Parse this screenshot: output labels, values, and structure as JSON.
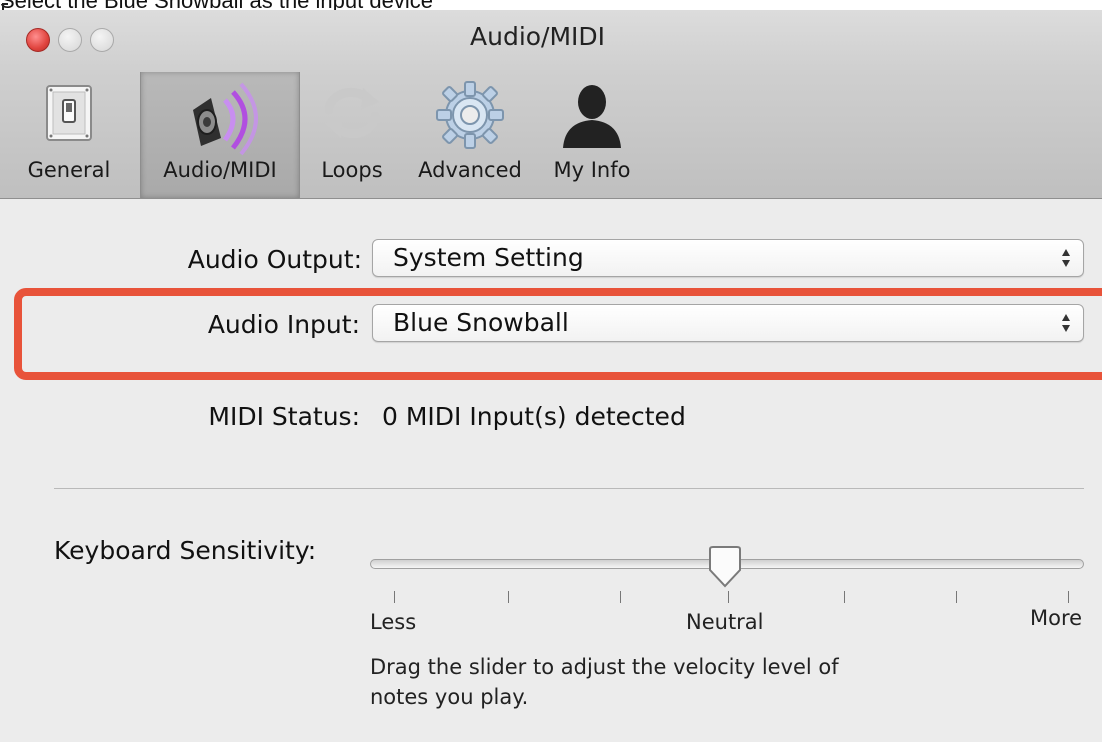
{
  "caption": "Select the Blue Snowball as the input device",
  "window": {
    "title": "Audio/MIDI",
    "controls": {
      "close": "close-button",
      "minimize": "minimize-button",
      "zoom": "zoom-button"
    }
  },
  "toolbar": {
    "items": [
      {
        "label": "General",
        "icon": "switch-icon",
        "selected": false
      },
      {
        "label": "Audio/MIDI",
        "icon": "speaker-icon",
        "selected": true
      },
      {
        "label": "Loops",
        "icon": "loops-icon",
        "selected": false
      },
      {
        "label": "Advanced",
        "icon": "gear-icon",
        "selected": false
      },
      {
        "label": "My Info",
        "icon": "person-icon",
        "selected": false
      }
    ]
  },
  "form": {
    "audio_output": {
      "label": "Audio Output:",
      "value": "System Setting"
    },
    "audio_input": {
      "label": "Audio Input:",
      "value": "Blue Snowball"
    },
    "midi_status": {
      "label": "MIDI Status:",
      "value": "0 MIDI Input(s) detected"
    }
  },
  "keyboard": {
    "label": "Keyboard Sensitivity:",
    "less": "Less",
    "neutral": "Neutral",
    "more": "More",
    "help": "Drag the slider to adjust the velocity level of notes you play.",
    "position_fraction": 0.5
  },
  "colors": {
    "highlight": "#e8533a",
    "accent": "#b14fe0"
  }
}
